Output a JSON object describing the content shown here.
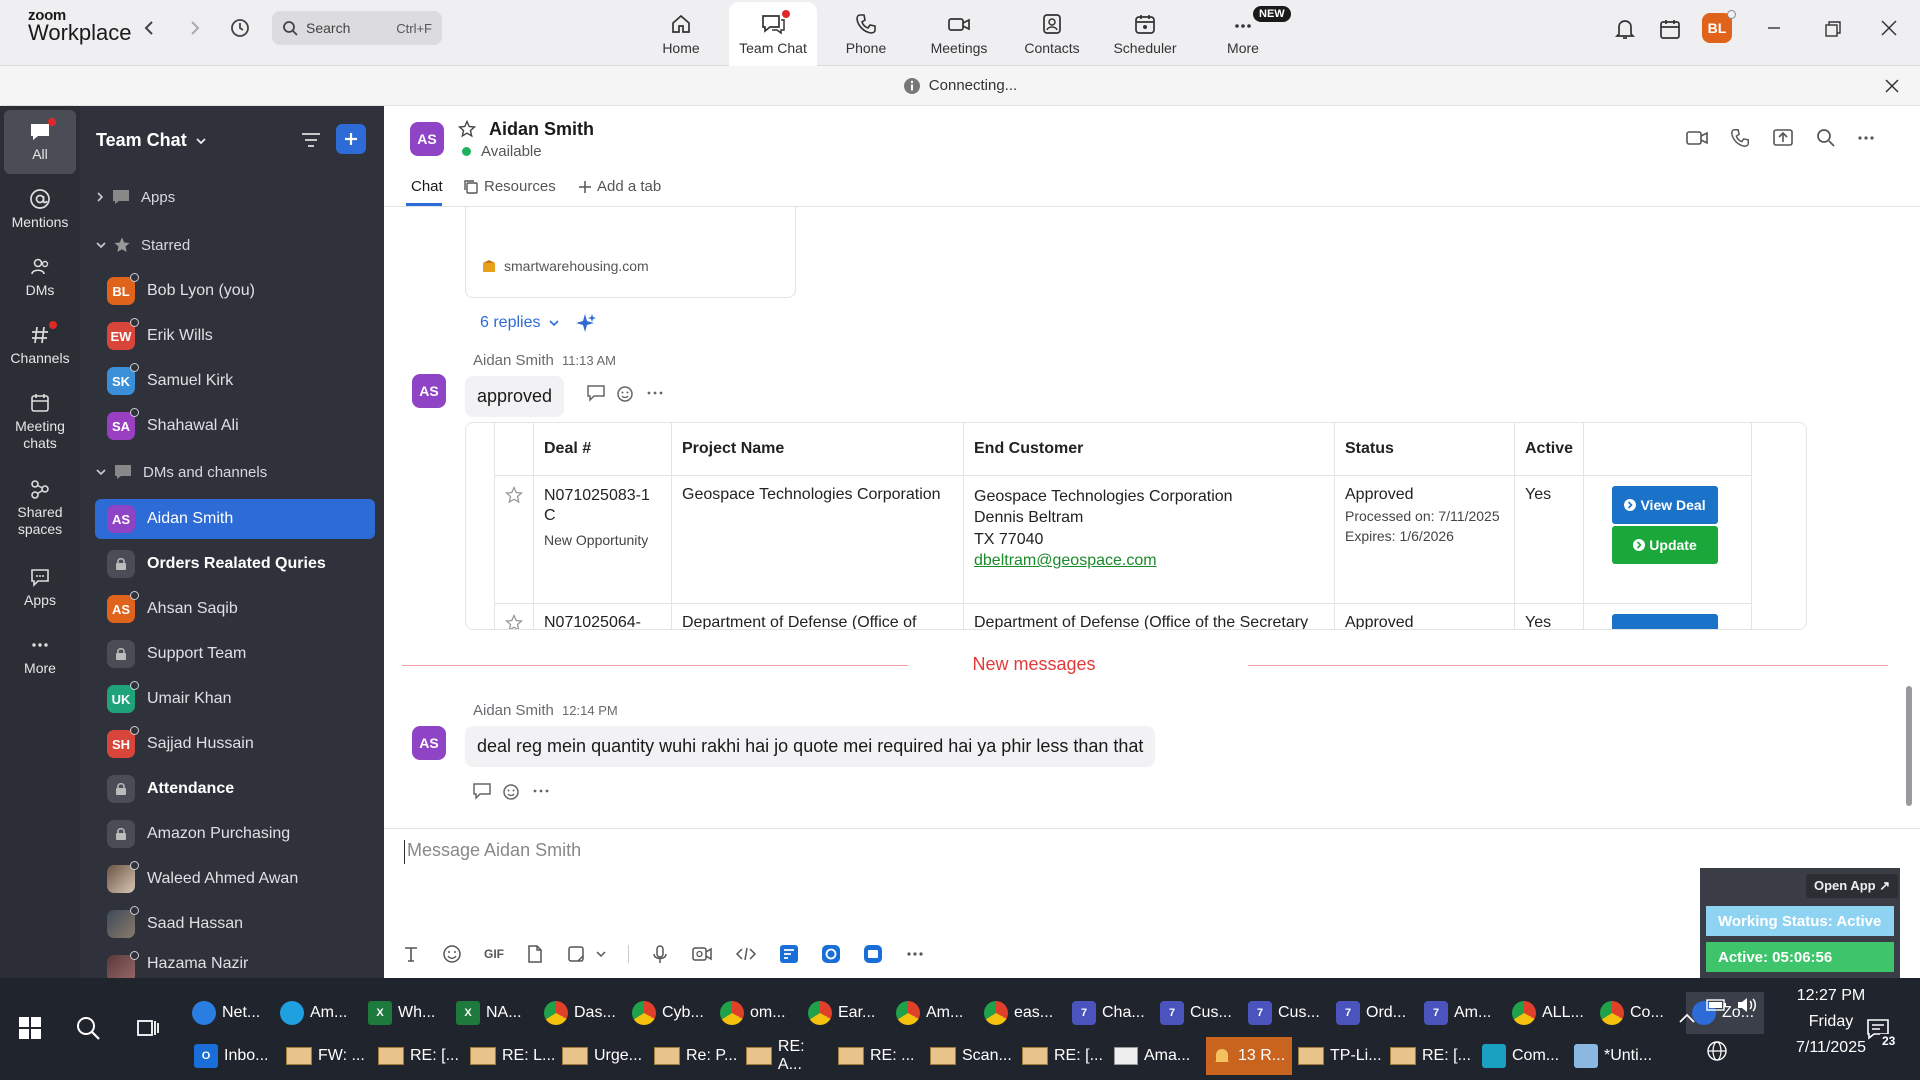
{
  "app": {
    "logo_line1": "zoom",
    "logo_line2": "Workplace"
  },
  "search": {
    "label": "Search",
    "shortcut": "Ctrl+F"
  },
  "top_tabs": [
    {
      "label": "Home",
      "icon": "home-icon"
    },
    {
      "label": "Team Chat",
      "icon": "chat-icon"
    },
    {
      "label": "Phone",
      "icon": "phone-icon"
    },
    {
      "label": "Meetings",
      "icon": "video-icon"
    },
    {
      "label": "Contacts",
      "icon": "contacts-icon"
    },
    {
      "label": "Scheduler",
      "icon": "calendar-icon"
    },
    {
      "label": "More",
      "icon": "more-icon"
    }
  ],
  "new_badge": "NEW",
  "user_initials": "BL",
  "connection_status": "Connecting...",
  "rail": [
    {
      "label": "All"
    },
    {
      "label": "Mentions"
    },
    {
      "label": "DMs"
    },
    {
      "label": "Channels"
    },
    {
      "label": "Meeting chats"
    },
    {
      "label": "Shared spaces"
    },
    {
      "label": "Apps"
    },
    {
      "label": "More"
    }
  ],
  "sidebar": {
    "title": "Team Chat",
    "section_apps": "Apps",
    "section_starred": "Starred",
    "starred": [
      {
        "name": "Bob Lyon (you)",
        "initials": "BL",
        "color": "#e0631b"
      },
      {
        "name": "Erik Wills",
        "initials": "EW",
        "color": "#d8453a"
      },
      {
        "name": "Samuel Kirk",
        "initials": "SK",
        "color": "#3a8fd8"
      },
      {
        "name": "Shahawal Ali",
        "initials": "SA",
        "color": "#9b3fc2"
      }
    ],
    "section_dms": "DMs and channels",
    "dms": [
      {
        "name": "Aidan Smith",
        "initials": "AS",
        "color": "#8e44c4",
        "type": "person"
      },
      {
        "name": "Orders Realated Quries",
        "type": "lock",
        "bold": true
      },
      {
        "name": "Ahsan Saqib",
        "initials": "AS",
        "color": "#e0631b",
        "type": "person"
      },
      {
        "name": "Support Team",
        "type": "lock"
      },
      {
        "name": "Umair Khan",
        "initials": "UK",
        "color": "#1fa37a",
        "type": "person"
      },
      {
        "name": "Sajjad Hussain",
        "initials": "SH",
        "color": "#d8453a",
        "type": "person"
      },
      {
        "name": "Attendance",
        "type": "lock",
        "bold": true
      },
      {
        "name": "Amazon Purchasing",
        "type": "lock"
      },
      {
        "name": "Waleed Ahmed Awan",
        "type": "photo"
      },
      {
        "name": "Saad Hassan",
        "type": "photo"
      },
      {
        "name": "Hazama Nazir",
        "type": "photo"
      }
    ]
  },
  "chat": {
    "contact_name": "Aidan Smith",
    "contact_initials": "AS",
    "presence": "Available",
    "tabs": {
      "chat": "Chat",
      "resources": "Resources",
      "add": "Add a tab"
    },
    "link_domain": "smartwarehousing.com",
    "replies": "6 replies",
    "msg1": {
      "sender": "Aidan Smith",
      "time": "11:13 AM",
      "text": "approved"
    },
    "deal_table": {
      "headers": [
        "Deal #",
        "Project Name",
        "End Customer",
        "Status",
        "Active"
      ],
      "row1": {
        "deal": "N071025083-1C",
        "deal_type": "New Opportunity",
        "project": "Geospace Technologies Corporation",
        "customer": "Geospace Technologies Corporation",
        "contact": "Dennis Beltram",
        "location": "TX 77040",
        "email": "dbeltram@geospace.com",
        "status": "Approved",
        "processed": "Processed on: 7/11/2025",
        "expires": "Expires: 1/6/2026",
        "active": "Yes"
      },
      "row2": {
        "deal": "N071025064-",
        "project": "Department of Defense (Office of",
        "customer": "Department of Defense (Office of the Secretary",
        "status": "Approved",
        "active": "Yes"
      },
      "btn_view": "View Deal",
      "btn_update": "Update"
    },
    "new_messages": "New messages",
    "msg2": {
      "sender": "Aidan Smith",
      "time": "12:14 PM",
      "text": "deal reg mein quantity wuhi rakhi hai jo quote mei required hai ya phir less than that"
    },
    "composer_placeholder": "Message Aidan Smith",
    "composer_gif": "GIF"
  },
  "widget": {
    "open_app": "Open App ↗",
    "working_status": "Working Status: Active",
    "active_timer": "Active: 05:06:56"
  },
  "taskbar": {
    "row1": [
      "Net...",
      "Am...",
      "Wh...",
      "NA...",
      "Das...",
      "Cyb...",
      "om...",
      "Ear...",
      "Am...",
      "eas...",
      "Cha...",
      "Cus...",
      "Cus...",
      "Ord...",
      "Am...",
      "ALL...",
      "Co...",
      "Zo..."
    ],
    "row2": [
      "Inbo...",
      "FW: ...",
      "RE: [...",
      "RE: L...",
      "Urge...",
      "Re: P...",
      "RE: A...",
      "RE: ...",
      "Scan...",
      "RE: [...",
      "Ama...",
      "13 R...",
      "TP-Li...",
      "RE: [...",
      "Com...",
      "*Unti..."
    ],
    "time": "12:27 PM",
    "day": "Friday",
    "date": "7/11/2025",
    "notif_count": "23",
    "teams_badge": "7"
  }
}
